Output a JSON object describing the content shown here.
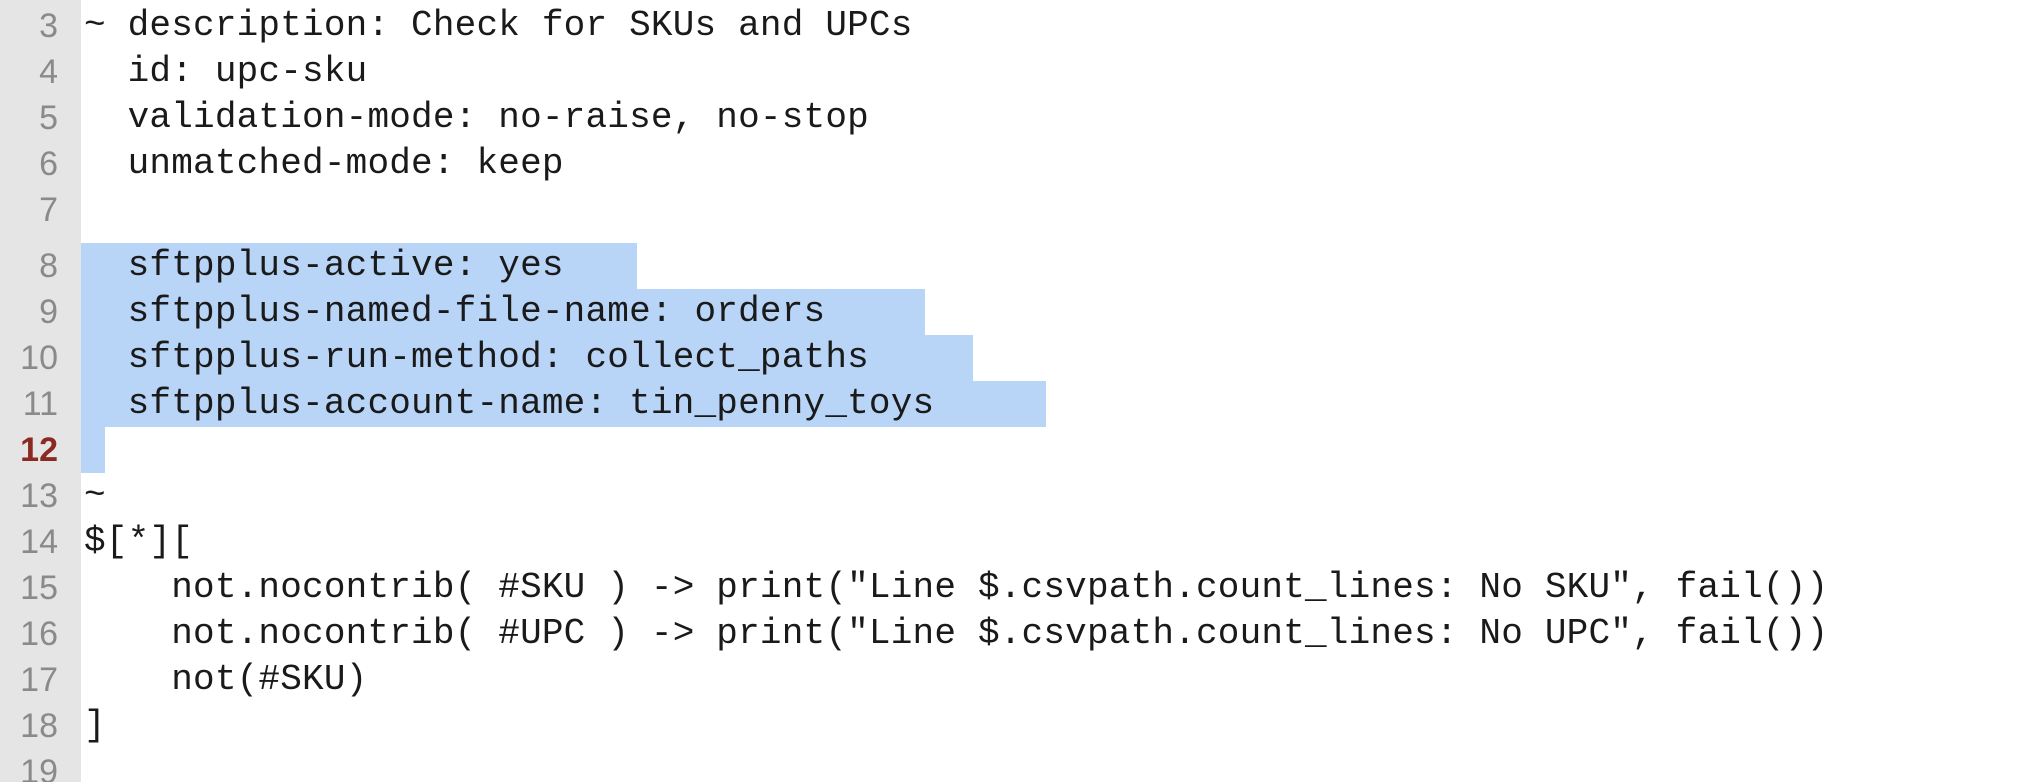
{
  "editor": {
    "active_line": "12",
    "lines": [
      {
        "num": "3",
        "text": "~ description: Check for SKUs and UPCs"
      },
      {
        "num": "4",
        "text": "  id: upc-sku"
      },
      {
        "num": "5",
        "text": "  validation-mode: no-raise, no-stop"
      },
      {
        "num": "6",
        "text": "  unmatched-mode: keep"
      },
      {
        "num": "7",
        "text": ""
      },
      {
        "num": "8",
        "text": "  sftpplus-active: yes"
      },
      {
        "num": "9",
        "text": "  sftpplus-named-file-name: orders"
      },
      {
        "num": "10",
        "text": "  sftpplus-run-method: collect_paths"
      },
      {
        "num": "11",
        "text": "  sftpplus-account-name: tin_penny_toys"
      },
      {
        "num": "12",
        "text": ""
      },
      {
        "num": "13",
        "text": "~"
      },
      {
        "num": "14",
        "text": "$[*]["
      },
      {
        "num": "15",
        "text": "    not.nocontrib( #SKU ) -> print(\"Line $.csvpath.count_lines: No SKU\", fail())"
      },
      {
        "num": "16",
        "text": "    not.nocontrib( #UPC ) -> print(\"Line $.csvpath.count_lines: No UPC\", fail())"
      },
      {
        "num": "17",
        "text": "    not(#SKU)"
      },
      {
        "num": "18",
        "text": "]"
      },
      {
        "num": "19",
        "text": ""
      }
    ],
    "selection_color": "#b8d4f7",
    "gutter_color": "#e5e5e5",
    "active_line_number_color": "#8b2a22"
  }
}
